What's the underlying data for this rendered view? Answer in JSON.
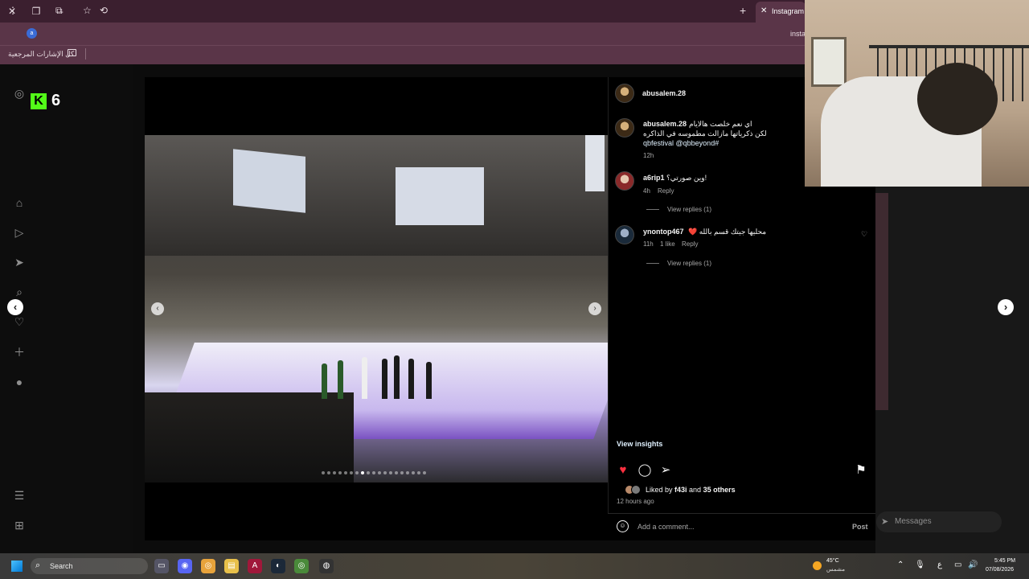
{
  "browser": {
    "tab_title": "Instagram",
    "url": "insta",
    "bookmarks_label": "كل الإشارات المرجعية"
  },
  "stream_overlay": {
    "logo_letter": "K",
    "count": "6"
  },
  "post": {
    "author": "abusalem.28",
    "comments": [
      {
        "user": "abusalem.28",
        "text_line1": "اي نعم خلصت هالايام",
        "text_line2": "لكن ذكرياتها مازالت مطموسه في الذاكره",
        "tags": "qbfestival @qbbeyond#",
        "time": "12h"
      },
      {
        "user": "a6rip1",
        "text": "وين صورتي؟!",
        "time": "4h",
        "reply": "Reply",
        "view_replies": "View replies (1)"
      },
      {
        "user": "ynontop467",
        "text": "❤️ محليها جيتك قسم بالله",
        "time": "11h",
        "likes": "1 like",
        "reply": "Reply",
        "view_replies": "View replies (1)"
      }
    ],
    "view_insights": "View insights",
    "liked_by_prefix": "Liked by ",
    "liked_by_user": "f43i",
    "liked_by_middle": " and ",
    "liked_by_others": "35 others",
    "time_ago": "12 hours ago",
    "add_comment_placeholder": "Add a comment...",
    "post_button": "Post",
    "media_dots_count": 19,
    "media_dots_active": 7
  },
  "messages": {
    "label": "Messages"
  },
  "taskbar": {
    "search_label": "Search",
    "weather_temp": "45°C",
    "weather_desc": "مشمس",
    "language": "ع",
    "time": "5:45 PM",
    "date": "07/08/2026"
  },
  "colors": {
    "like_red": "#ff3040",
    "link_blue": "#e0f1ff",
    "kick_green": "#53fc18",
    "browser_frame": "#5a3548"
  }
}
